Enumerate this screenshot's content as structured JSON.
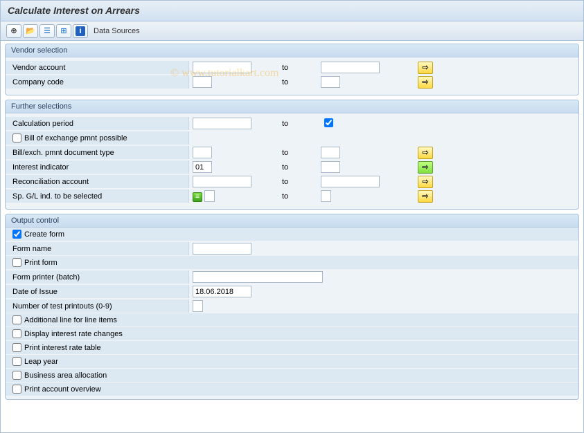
{
  "title": "Calculate Interest on Arrears",
  "watermark": "© www.tutorialkart.com",
  "toolbar": {
    "data_sources": "Data Sources"
  },
  "groups": {
    "vendor_selection": {
      "title": "Vendor selection",
      "vendor_account": {
        "label": "Vendor account",
        "from": "",
        "to_label": "to",
        "to": ""
      },
      "company_code": {
        "label": "Company code",
        "from": "",
        "to_label": "to",
        "to": ""
      }
    },
    "further_selections": {
      "title": "Further selections",
      "calc_period": {
        "label": "Calculation period",
        "from": "",
        "to_label": "to",
        "to_checked": true
      },
      "bill_exchange_possible": {
        "label": "Bill of exchange pmnt possible",
        "checked": false
      },
      "bill_exch_doc_type": {
        "label": "Bill/exch. pmnt document type",
        "from": "",
        "to_label": "to",
        "to": ""
      },
      "interest_indicator": {
        "label": "Interest indicator",
        "from": "01",
        "to_label": "to",
        "to": ""
      },
      "reconciliation_account": {
        "label": "Reconciliation account",
        "from": "",
        "to_label": "to",
        "to": ""
      },
      "sp_gl_ind": {
        "label": "Sp. G/L ind. to be selected",
        "from": "",
        "to_label": "to",
        "to": ""
      }
    },
    "output_control": {
      "title": "Output control",
      "create_form": {
        "label": "Create form",
        "checked": true
      },
      "form_name": {
        "label": "Form name",
        "value": ""
      },
      "print_form": {
        "label": "Print form",
        "checked": false
      },
      "form_printer": {
        "label": "Form printer (batch)",
        "value": ""
      },
      "date_of_issue": {
        "label": "Date of Issue",
        "value": "18.06.2018"
      },
      "num_test_printouts": {
        "label": "Number of test printouts (0-9)",
        "value": ""
      },
      "additional_line": {
        "label": "Additional line for line items",
        "checked": false
      },
      "display_rate_changes": {
        "label": "Display interest rate changes",
        "checked": false
      },
      "print_rate_table": {
        "label": "Print interest rate table",
        "checked": false
      },
      "leap_year": {
        "label": "Leap year",
        "checked": false
      },
      "business_area": {
        "label": "Business area allocation",
        "checked": false
      },
      "print_account_overview": {
        "label": "Print account overview",
        "checked": false
      }
    }
  }
}
